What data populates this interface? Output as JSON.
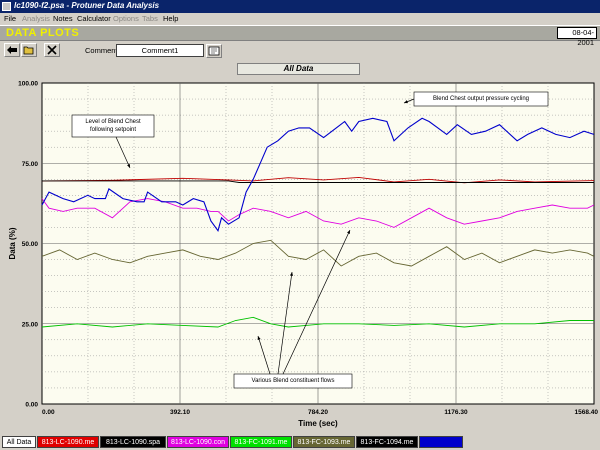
{
  "window": {
    "title": "lc1090-f2.psa - Protuner Data  Analysis"
  },
  "menu": [
    {
      "label": "File",
      "enabled": true
    },
    {
      "label": "Analysis",
      "enabled": false
    },
    {
      "label": "Notes",
      "enabled": true
    },
    {
      "label": "Calculator",
      "enabled": true
    },
    {
      "label": "Options",
      "enabled": false
    },
    {
      "label": "Tabs",
      "enabled": false
    },
    {
      "label": "Help",
      "enabled": true
    }
  ],
  "header": {
    "title": "DATA PLOTS",
    "date": "08-04-2001"
  },
  "toolbar": {
    "comment_label": "Comment",
    "comment_value": "Comment1"
  },
  "plot": {
    "title": "All Data"
  },
  "chart_data": {
    "type": "line",
    "title": "All Data",
    "xlabel": "Time (sec)",
    "ylabel": "Data (%)",
    "xlim": [
      0,
      1568.4
    ],
    "ylim": [
      0,
      100
    ],
    "xticks": [
      "0.00",
      "392.10",
      "784.20",
      "1176.30",
      "1568.40"
    ],
    "yticks": [
      "0.00",
      "25.00",
      "50.00",
      "75.00",
      "100.00"
    ],
    "grid": true,
    "series": [
      {
        "name": "813-LC-1090.me",
        "color": "#c00000",
        "x": [
          0,
          200,
          400,
          530,
          600,
          700,
          800,
          900,
          1000,
          1100,
          1200,
          1300,
          1400,
          1568
        ],
        "y": [
          69.5,
          69.7,
          70.3,
          69.8,
          69.5,
          70.5,
          69.8,
          70.6,
          69.2,
          70.0,
          68.9,
          69.8,
          69.2,
          69.6
        ]
      },
      {
        "name": "813-LC-1090.spa",
        "color": "#000000",
        "x": [
          0,
          200,
          400,
          530,
          560,
          800,
          1000,
          1200,
          1400,
          1568
        ],
        "y": [
          69.5,
          69.5,
          69.5,
          69.5,
          69.0,
          69.0,
          69.0,
          69.0,
          69.0,
          69.0
        ]
      },
      {
        "name": "813-LC-1090.con",
        "color": "#e000e0",
        "x": [
          0,
          20,
          60,
          100,
          150,
          200,
          250,
          300,
          350,
          400,
          440,
          480,
          500,
          530,
          560,
          600,
          650,
          700,
          750,
          800,
          850,
          900,
          950,
          1000,
          1050,
          1100,
          1150,
          1200,
          1250,
          1300,
          1350,
          1400,
          1450,
          1500,
          1550,
          1568
        ],
        "y": [
          64,
          61,
          60,
          61,
          61,
          58,
          63,
          64,
          63,
          61,
          61,
          60,
          60,
          57,
          59,
          61,
          60,
          58,
          60,
          57,
          56,
          58,
          57,
          55,
          58,
          61,
          58,
          56,
          57,
          58,
          60,
          61,
          62,
          61,
          61,
          62
        ]
      },
      {
        "name": "813-FC-1091.me",
        "color": "#00c000",
        "x": [
          0,
          100,
          200,
          300,
          400,
          500,
          550,
          600,
          650,
          700,
          750,
          800,
          900,
          1000,
          1100,
          1200,
          1300,
          1400,
          1500,
          1568
        ],
        "y": [
          24,
          25,
          24,
          25,
          24.5,
          24,
          26,
          27,
          25,
          24,
          24.5,
          25,
          25,
          24.5,
          25,
          24,
          25,
          25,
          26,
          26
        ]
      },
      {
        "name": "813-FC-1093.me",
        "color": "#666633",
        "x": [
          0,
          50,
          100,
          150,
          200,
          250,
          300,
          350,
          400,
          450,
          500,
          550,
          600,
          650,
          700,
          750,
          800,
          850,
          900,
          950,
          1000,
          1050,
          1100,
          1150,
          1200,
          1250,
          1300,
          1350,
          1400,
          1450,
          1500,
          1550,
          1568
        ],
        "y": [
          46,
          48,
          45,
          47,
          45,
          44,
          46,
          47,
          48,
          46,
          45,
          47,
          50,
          51,
          46,
          45,
          48,
          43,
          46,
          47,
          44,
          43,
          46,
          49,
          45,
          47,
          44,
          46,
          48,
          47,
          48,
          47,
          46
        ]
      },
      {
        "name": "813-FC-1094.me",
        "color": "#0000cc",
        "x": [
          0,
          20,
          60,
          90,
          130,
          150,
          180,
          190,
          230,
          270,
          290,
          300,
          340,
          380,
          400,
          430,
          460,
          480,
          500,
          510,
          530,
          560,
          580,
          600,
          620,
          640,
          670,
          700,
          730,
          760,
          800,
          860,
          880,
          900,
          940,
          980,
          1000,
          1040,
          1080,
          1100,
          1150,
          1180,
          1220,
          1260,
          1300,
          1350,
          1380,
          1420,
          1460,
          1500,
          1540,
          1568
        ],
        "y": [
          62,
          66,
          64,
          63,
          65,
          64,
          64,
          67,
          64,
          63,
          63,
          66,
          63,
          63,
          62,
          64,
          63,
          57,
          54,
          58,
          56,
          58,
          66,
          70,
          75,
          80,
          82,
          85,
          86,
          86,
          83,
          88,
          85,
          88,
          89,
          88,
          82,
          86,
          89,
          88,
          84,
          87,
          84,
          85,
          87,
          82,
          84,
          86,
          84,
          83,
          85,
          84
        ]
      }
    ],
    "annotations": [
      "Blend Chest output pressure cycling",
      "Level of Blend Chest following setpoint",
      "Various Blend constituent flows"
    ]
  },
  "tabs": [
    {
      "label": "All Data",
      "color": "#ffffff",
      "text": "#000000"
    },
    {
      "label": "813-LC-1090.me",
      "color": "#e00000",
      "text": "#ffffff"
    },
    {
      "label": "813-LC-1090.spa",
      "color": "#000000",
      "text": "#ffffff"
    },
    {
      "label": "813-LC-1090.con",
      "color": "#e000e0",
      "text": "#ffffff"
    },
    {
      "label": "813-FC-1091.me",
      "color": "#00e000",
      "text": "#ffffff"
    },
    {
      "label": "813-FC-1093.me",
      "color": "#666633",
      "text": "#ffffff"
    },
    {
      "label": "813-FC-1094.me",
      "color": "#000000",
      "text": "#ffffff"
    },
    {
      "label": "",
      "color": "#0000cc",
      "text": "#ffffff"
    }
  ]
}
